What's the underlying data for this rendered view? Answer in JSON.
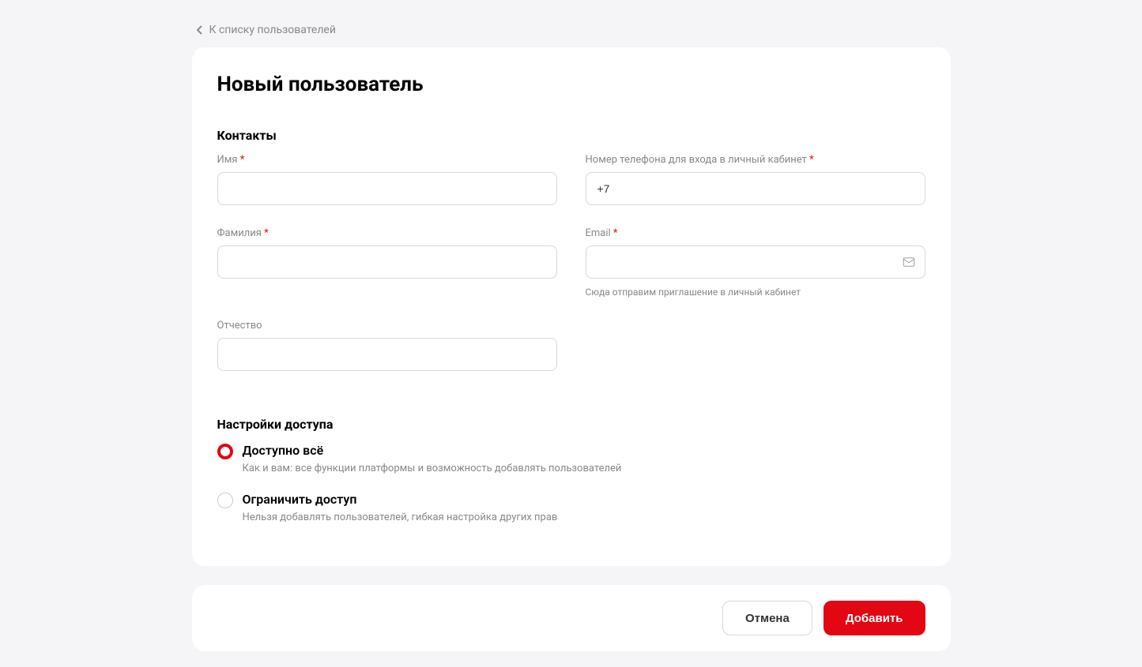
{
  "back_link_label": "К списку пользователей",
  "page_title": "Новый пользователь",
  "sections": {
    "contacts": {
      "title": "Контакты",
      "fields": {
        "first_name": {
          "label": "Имя",
          "required": "*"
        },
        "last_name": {
          "label": "Фамилия",
          "required": "*"
        },
        "middle_name": {
          "label": "Отчество"
        },
        "phone": {
          "label": "Номер телефона для входа в личный кабинет",
          "required": "*",
          "value": "+7"
        },
        "email": {
          "label": "Email",
          "required": "*",
          "help": "Сюда отправим приглашение в личный кабинет"
        }
      }
    },
    "access": {
      "title": "Настройки доступа",
      "options": [
        {
          "label": "Доступно всё",
          "desc": "Как и вам: все функции платформы и возможность добавлять пользователей",
          "selected": true
        },
        {
          "label": "Ограничить доступ",
          "desc": "Нельзя добавлять пользователей, гибкая настройка других прав",
          "selected": false
        }
      ]
    }
  },
  "footer": {
    "cancel_label": "Отмена",
    "submit_label": "Добавить"
  }
}
